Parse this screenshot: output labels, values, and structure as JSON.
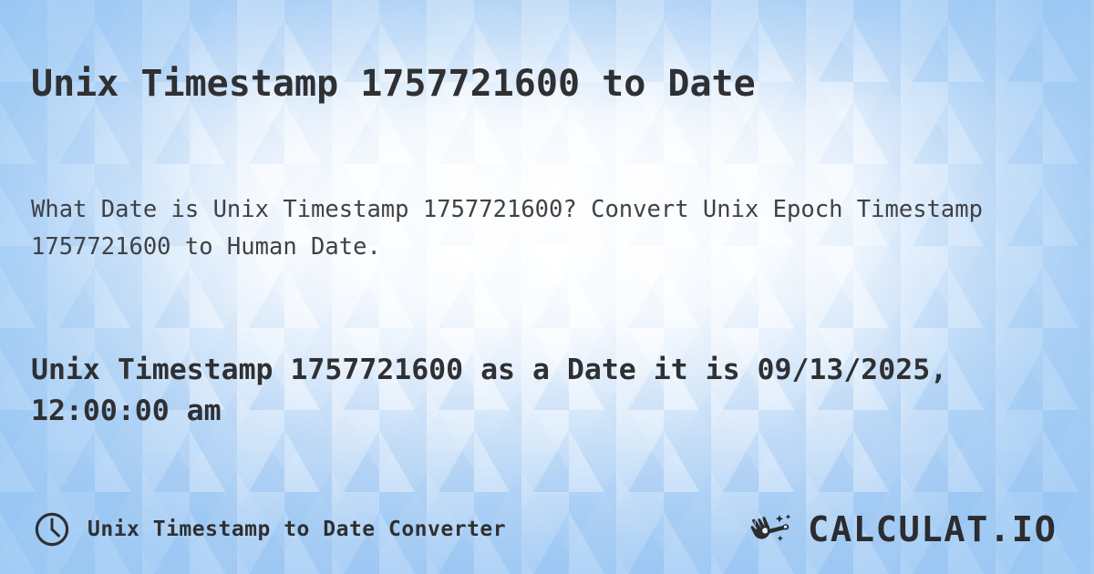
{
  "page": {
    "title": "Unix Timestamp 1757721600 to Date",
    "description": "What Date is Unix Timestamp 1757721600? Convert Unix Epoch Timestamp 1757721600 to Human Date.",
    "result_heading": "Unix Timestamp 1757721600 as a Date it is 09/13/2025, 12:00:00 am"
  },
  "values": {
    "timestamp": "1757721600",
    "human_date": "09/13/2025, 12:00:00 am"
  },
  "footer": {
    "icon": "clock-icon",
    "label": "Unix Timestamp to Date Converter",
    "brand_icon": "magic-wand-hand-icon",
    "brand_text": "CALCULAT.IO"
  },
  "colors": {
    "text_primary": "#2f3033",
    "text_secondary": "#3f4145",
    "background_center": "#ffffff",
    "background_edge": "#a3caf3",
    "mosaic_blue": "#8fc0f0"
  }
}
